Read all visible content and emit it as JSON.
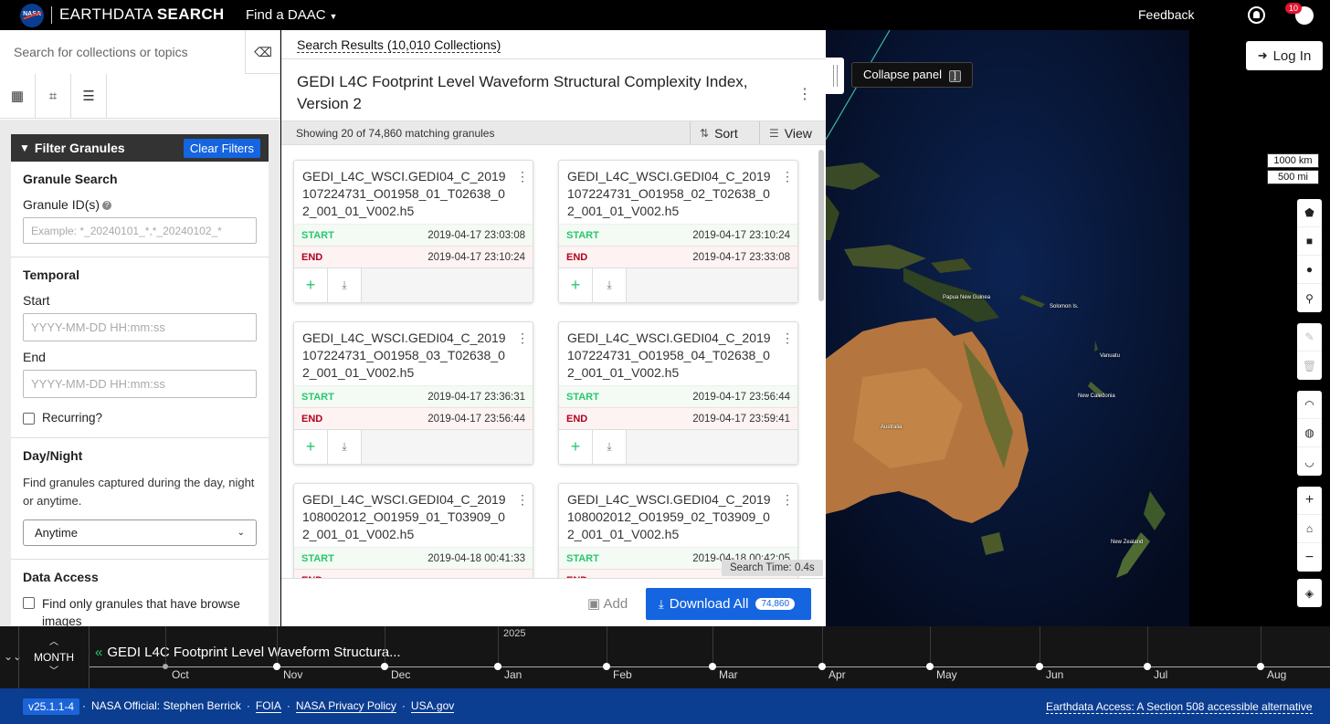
{
  "header": {
    "nasa_logo_text": "NASA",
    "brand_light": "EARTHDATA",
    "brand_bold": "SEARCH",
    "find_daac": "Find a DAAC",
    "feedback": "Feedback",
    "notification_count": "10"
  },
  "sidebar": {
    "search_placeholder": "Search for collections or topics",
    "filter_title": "Filter Granules",
    "clear_filters": "Clear Filters",
    "granule_search": {
      "heading": "Granule Search",
      "label": "Granule ID(s)",
      "placeholder": "Example: *_20240101_*,*_20240102_*"
    },
    "temporal": {
      "heading": "Temporal",
      "start_label": "Start",
      "start_placeholder": "YYYY-MM-DD HH:mm:ss",
      "end_label": "End",
      "end_placeholder": "YYYY-MM-DD HH:mm:ss",
      "recurring": "Recurring?"
    },
    "day_night": {
      "heading": "Day/Night",
      "description": "Find granules captured during the day, night or anytime.",
      "selected": "Anytime"
    },
    "data_access": {
      "heading": "Data Access",
      "browse_only": "Find only granules that have browse images"
    }
  },
  "results": {
    "breadcrumb": "Search Results (10,010 Collections)",
    "collection_title": "GEDI L4C Footprint Level Waveform Structural Complexity Index, Version 2",
    "showing": "Showing 20 of 74,860 matching granules",
    "sort_label": "Sort",
    "view_label": "View",
    "start_label": "START",
    "end_label": "END",
    "search_time": "Search Time: 0.4s",
    "add_label": "Add",
    "download_all": "Download All",
    "download_count": "74,860",
    "granules": [
      {
        "name": "GEDI_L4C_WSCI.GEDI04_C_2019107224731_O01958_01_T02638_02_001_01_V002.h5",
        "start": "2019-04-17 23:03:08",
        "end": "2019-04-17 23:10:24"
      },
      {
        "name": "GEDI_L4C_WSCI.GEDI04_C_2019107224731_O01958_02_T02638_02_001_01_V002.h5",
        "start": "2019-04-17 23:10:24",
        "end": "2019-04-17 23:33:08"
      },
      {
        "name": "GEDI_L4C_WSCI.GEDI04_C_2019107224731_O01958_03_T02638_02_001_01_V002.h5",
        "start": "2019-04-17 23:36:31",
        "end": "2019-04-17 23:56:44"
      },
      {
        "name": "GEDI_L4C_WSCI.GEDI04_C_2019107224731_O01958_04_T02638_02_001_01_V002.h5",
        "start": "2019-04-17 23:56:44",
        "end": "2019-04-17 23:59:41"
      },
      {
        "name": "GEDI_L4C_WSCI.GEDI04_C_2019108002012_O01959_01_T03909_02_001_01_V002.h5",
        "start": "2019-04-18 00:41:33",
        "end": ""
      },
      {
        "name": "GEDI_L4C_WSCI.GEDI04_C_2019108002012_O01959_02_T03909_02_001_01_V002.h5",
        "start": "2019-04-18 00:42:05",
        "end": ""
      }
    ]
  },
  "map": {
    "collapse_tip": "Collapse panel",
    "collapse_key": "]",
    "login": "Log In",
    "scale_km": "1000 km",
    "scale_mi": "500 mi",
    "places": [
      "Papua New Guinea",
      "Solomon Is.",
      "Vanuatu",
      "New Caledonia",
      "Australia",
      "New Zealand"
    ]
  },
  "timeline": {
    "zoom_level": "MONTH",
    "title": "GEDI L4C Footprint Level Waveform Structura...",
    "year": "2025",
    "months": [
      "Oct",
      "Nov",
      "Dec",
      "Jan",
      "Feb",
      "Mar",
      "Apr",
      "May",
      "Jun",
      "Jul",
      "Aug"
    ]
  },
  "footer": {
    "version": "v25.1.1-4",
    "official": "NASA Official: Stephen Berrick",
    "foia": "FOIA",
    "privacy": "NASA Privacy Policy",
    "usagov": "USA.gov",
    "accessible": "Earthdata Access: A Section 508 accessible alternative"
  },
  "colors": {
    "primary_blue": "#1565e0",
    "start_green": "#28c76f",
    "end_red": "#b3001e",
    "footer_blue": "#0b3d91"
  }
}
